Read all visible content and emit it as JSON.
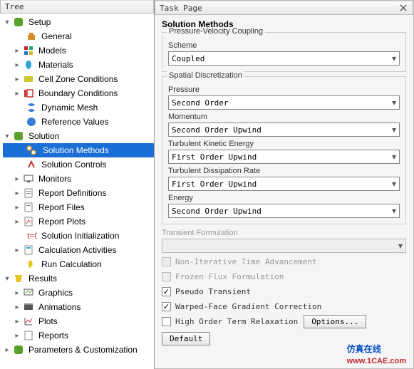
{
  "leftTitle": "Tree",
  "rightTitle": "Task Page",
  "tree": {
    "setup": "Setup",
    "general": "General",
    "models": "Models",
    "materials": "Materials",
    "cellzone": "Cell Zone Conditions",
    "boundary": "Boundary Conditions",
    "dynmesh": "Dynamic Mesh",
    "refvalues": "Reference Values",
    "solution": "Solution",
    "solmethods": "Solution Methods",
    "solcontrols": "Solution Controls",
    "monitors": "Monitors",
    "reportdef": "Report Definitions",
    "reportfiles": "Report Files",
    "reportplots": "Report Plots",
    "solinit": "Solution Initialization",
    "calcact": "Calculation Activities",
    "runcalc": "Run Calculation",
    "results": "Results",
    "graphics": "Graphics",
    "animations": "Animations",
    "plots": "Plots",
    "reports": "Reports",
    "params": "Parameters & Customization"
  },
  "task": {
    "title": "Solution Methods",
    "pvc": "Pressure-Velocity Coupling",
    "scheme_label": "Scheme",
    "scheme": "Coupled",
    "sd": "Spatial Discretization",
    "pressure_label": "Pressure",
    "pressure": "Second Order",
    "momentum_label": "Momentum",
    "momentum": "Second Order Upwind",
    "tke_label": "Turbulent Kinetic Energy",
    "tke": "First Order Upwind",
    "tdr_label": "Turbulent Dissipation Rate",
    "tdr": "First Order Upwind",
    "energy_label": "Energy",
    "energy": "Second Order Upwind",
    "tf_label": "Transient Formulation",
    "c1": "Non-Iterative Time Advancement",
    "c2": "Frozen Flux Formulation",
    "c3": "Pseudo Transient",
    "c4": "Warped-Face Gradient Correction",
    "c5": "High Order Term Relaxation",
    "options": "Options...",
    "default": "Default"
  },
  "wm": {
    "zh": "仿真在线",
    "url": "www.1CAE.com"
  }
}
